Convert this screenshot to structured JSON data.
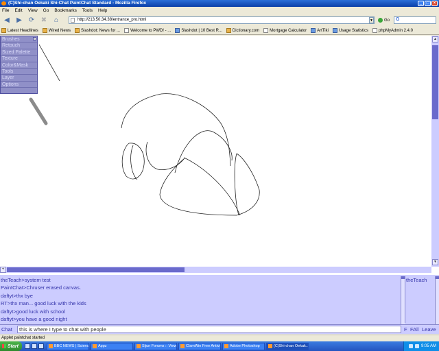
{
  "window": {
    "title": "(C)Shi-chan Oekaki Shi-Chat PaintChat Standard - Mozilla Firefox",
    "controls": [
      "_",
      "□",
      "×"
    ]
  },
  "menu": [
    "File",
    "Edit",
    "View",
    "Go",
    "Bookmarks",
    "Tools",
    "Help"
  ],
  "nav": {
    "url": "http://213.50.34.38/entrance_pro.html",
    "go_label": "Go",
    "search_placeholder": ""
  },
  "bookmarks": [
    {
      "label": "Latest Headlines",
      "icon": "rss-folder-icon"
    },
    {
      "label": "Wired News",
      "icon": "rss-folder-icon"
    },
    {
      "label": "Slashdot: News for ...",
      "icon": "rss-folder-icon"
    },
    {
      "label": "Welcome to PWD! - ...",
      "icon": "page-icon"
    },
    {
      "label": "Slashdot | 10 Best R...",
      "icon": "slashdot-icon"
    },
    {
      "label": "Dictionary.com",
      "icon": "dictionary-icon"
    },
    {
      "label": "Mortgage Calculator",
      "icon": "page-icon"
    },
    {
      "label": "ArtTiki",
      "icon": "arttiki-icon"
    },
    {
      "label": "Usage Statistics",
      "icon": "stats-icon"
    },
    {
      "label": "phpMyAdmin 2.4.0",
      "icon": "page-icon"
    }
  ],
  "tool_menu": [
    "Brushes",
    "Retouch",
    "Sized Palette",
    "Texture",
    "Color&Mask",
    "Tools",
    "Layer",
    "Options"
  ],
  "chat": {
    "messages": [
      "theTeach>system test",
      "PaintChat>Chruser erased canvas.",
      "daftyt>thx bye",
      "RT>thx man... good luck with the kids",
      "daftyt>good luck with school",
      "daftyt>you have a good night"
    ],
    "users": [
      "theTeach"
    ],
    "label": "Chat",
    "input_value": "this is where I type to chat with people",
    "buttons": {
      "f": "F",
      "fall": "FAll",
      "leave": "Leave"
    }
  },
  "status": "Applet paintchat started",
  "taskbar": {
    "start": "Start",
    "tasks": [
      "BBC NEWS | Science...",
      "Appz",
      "Sijun Forums :: View...",
      "ClamWin Free Antivi...",
      "Adobe Photoshop",
      "(C)Shi-chan Oekak..."
    ],
    "clock": "9:05 AM"
  },
  "colors": {
    "panel_bg": "#ccccff",
    "panel_text": "#3333aa",
    "scroll_thumb": "#6a6acc"
  }
}
